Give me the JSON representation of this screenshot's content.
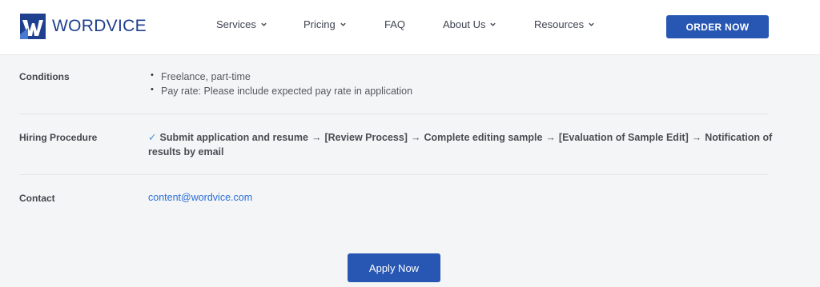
{
  "header": {
    "logo_text": "WORDVICE",
    "nav": [
      {
        "label": "Services"
      },
      {
        "label": "Pricing"
      },
      {
        "label": "FAQ"
      },
      {
        "label": "About Us"
      },
      {
        "label": "Resources"
      }
    ],
    "order_button": "ORDER NOW"
  },
  "rows": {
    "conditions": {
      "label": "Conditions",
      "items": [
        "Freelance, part-time",
        "Pay rate: Please include expected pay rate in application"
      ]
    },
    "hiring": {
      "label": "Hiring Procedure",
      "steps": [
        "Submit application and resume",
        "[Review Process]",
        "Complete editing sample",
        "[Evaluation of Sample Edit]",
        "Notification of results by email"
      ],
      "check_symbol": "✓",
      "arrow_symbol": "→"
    },
    "contact": {
      "label": "Contact",
      "email": "content@wordvice.com"
    }
  },
  "apply_button": "Apply Now",
  "colors": {
    "brand_blue": "#2756b3",
    "link_blue": "#2a6fdb",
    "background": "#f4f5f6"
  }
}
